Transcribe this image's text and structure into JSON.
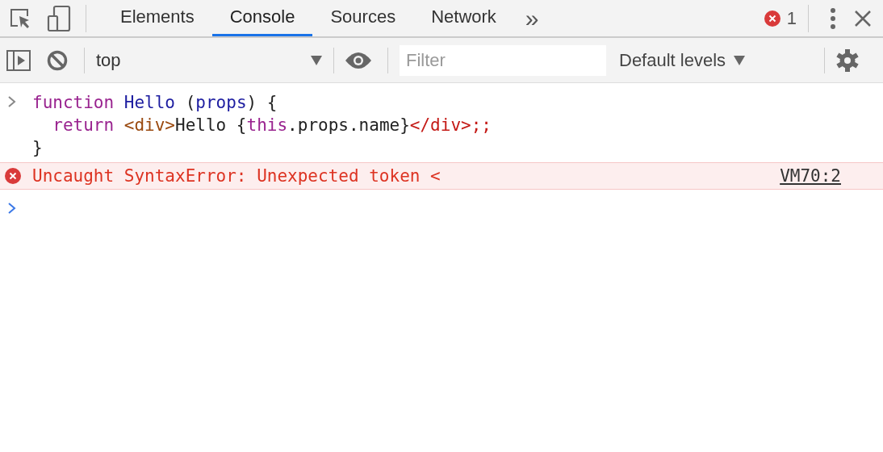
{
  "tabs": [
    {
      "label": "Elements",
      "selected": false
    },
    {
      "label": "Console",
      "selected": true
    },
    {
      "label": "Sources",
      "selected": false
    },
    {
      "label": "Network",
      "selected": false
    }
  ],
  "more_tabs": "»",
  "error_count": "1",
  "toolbar": {
    "context": "top",
    "filter": {
      "placeholder": "Filter"
    },
    "levels": "Default levels"
  },
  "console": {
    "input_lines": [
      {
        "indented": false,
        "tokens": [
          {
            "kind": "keyword",
            "text": "function "
          },
          {
            "kind": "definition",
            "text": "Hello"
          },
          {
            "kind": "plain",
            "text": " ("
          },
          {
            "kind": "variable",
            "text": "props"
          },
          {
            "kind": "plain",
            "text": ") {"
          }
        ]
      },
      {
        "indented": true,
        "tokens": [
          {
            "kind": "keyword",
            "text": "return "
          },
          {
            "kind": "tag",
            "text": "<div>"
          },
          {
            "kind": "plain",
            "text": "Hello {"
          },
          {
            "kind": "keyword",
            "text": "this"
          },
          {
            "kind": "plain",
            "text": ".props.name}"
          },
          {
            "kind": "invalid",
            "text": "</div>;;"
          }
        ]
      },
      {
        "indented": false,
        "tokens": [
          {
            "kind": "plain",
            "text": "}"
          }
        ]
      }
    ],
    "error": {
      "message": "Uncaught SyntaxError: Unexpected token <",
      "source": "VM70:2"
    }
  }
}
